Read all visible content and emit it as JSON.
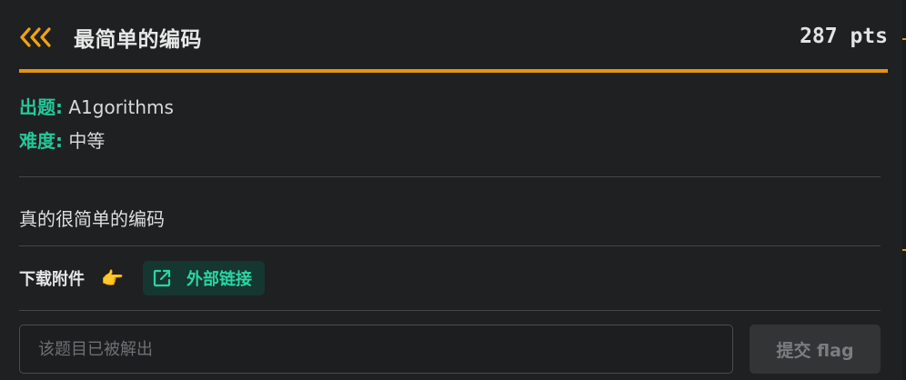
{
  "challenge": {
    "title": "最简单的编码",
    "points": "287 pts",
    "author_label": "出题:",
    "author": "A1gorithms",
    "difficulty_label": "难度:",
    "difficulty": "中等",
    "description": "真的很简单的编码"
  },
  "attachments": {
    "label": "下载附件",
    "hand_icon": "pointing-hand-icon",
    "hand_glyph": "👉",
    "link_icon": "external-link-icon",
    "link_label": "外部链接"
  },
  "submit": {
    "placeholder": "该题目已被解出",
    "button_label": "提交 flag"
  },
  "colors": {
    "accent": "#e7920f",
    "label_green": "#25c79a",
    "link_bg": "#163631",
    "background": "#1e2021"
  }
}
